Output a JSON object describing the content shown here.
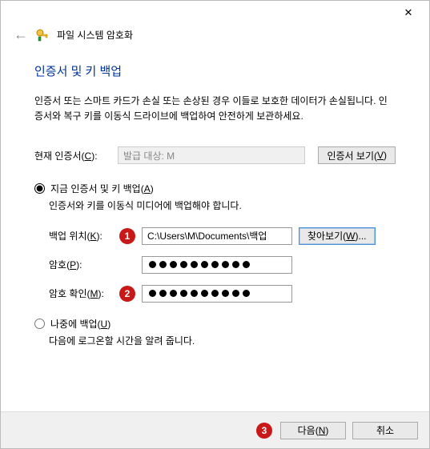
{
  "window": {
    "close_glyph": "✕"
  },
  "header": {
    "back_glyph": "←",
    "title": "파일 시스템 암호화"
  },
  "page": {
    "title": "인증서 및 키 백업",
    "description": "인증서 또는 스마트 카드가 손실 또는 손상된 경우 이들로 보호한 데이터가 손실됩니다. 인증서와 복구 키를 이동식 드라이브에 백업하여 안전하게 보관하세요."
  },
  "cert": {
    "label_pre": "현재 인증서(",
    "label_key": "C",
    "label_post": "):",
    "value": "발급 대상: M",
    "view_btn_pre": "인증서 보기(",
    "view_btn_key": "V",
    "view_btn_post": ")"
  },
  "backup_now": {
    "radio_pre": "지금 인증서 및 키 백업(",
    "radio_key": "A",
    "radio_post": ")",
    "sub": "인증서와 키를 이동식 미디어에 백업해야 합니다.",
    "location_label_pre": "백업 위치(",
    "location_label_key": "K",
    "location_label_post": "):",
    "location_value": "C:\\Users\\M\\Documents\\백업",
    "browse_pre": "찾아보기(",
    "browse_key": "W",
    "browse_post": ")...",
    "pwd_label_pre": "암호(",
    "pwd_label_key": "P",
    "pwd_label_post": "):",
    "pwd_confirm_pre": "암호 확인(",
    "pwd_confirm_key": "M",
    "pwd_confirm_post": "):",
    "pwd_dots": 10
  },
  "backup_later": {
    "radio_pre": "나중에 백업(",
    "radio_key": "U",
    "radio_post": ")",
    "sub": "다음에 로그온할 시간을 알려 줍니다."
  },
  "markers": {
    "m1": "1",
    "m2": "2",
    "m3": "3"
  },
  "footer": {
    "next_pre": "다음(",
    "next_key": "N",
    "next_post": ")",
    "cancel": "취소"
  }
}
